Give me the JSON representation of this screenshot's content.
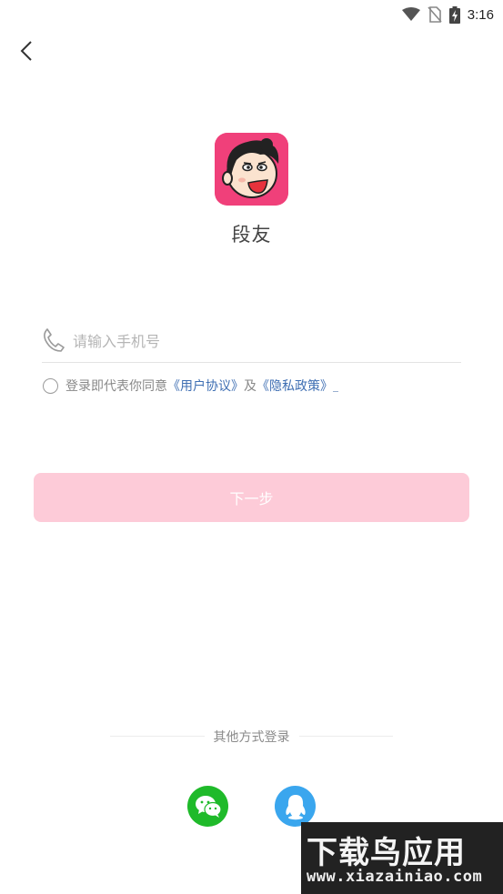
{
  "status_bar": {
    "time": "3:16"
  },
  "app": {
    "name": "段友"
  },
  "phone": {
    "placeholder": "请输入手机号",
    "value": ""
  },
  "agreement": {
    "text": "登录即代表你同意",
    "user_agreement": "《用户协议》",
    "and": "及",
    "privacy_policy": "《隐私政策》",
    "checked": false
  },
  "next_button": {
    "label": "下一步"
  },
  "other_login": {
    "title": "其他方式登录",
    "methods": [
      {
        "name": "wechat",
        "icon": "wechat-icon",
        "color": "#1fba2a"
      },
      {
        "name": "qq",
        "icon": "qq-icon",
        "color": "#3aa6ee"
      }
    ]
  },
  "colors": {
    "accent": "#f0407a",
    "button_disabled": "#fdcbd8",
    "link": "#3f6fb3"
  },
  "watermark": {
    "title": "下载鸟应用",
    "url": "www.xiazainiao.com"
  }
}
